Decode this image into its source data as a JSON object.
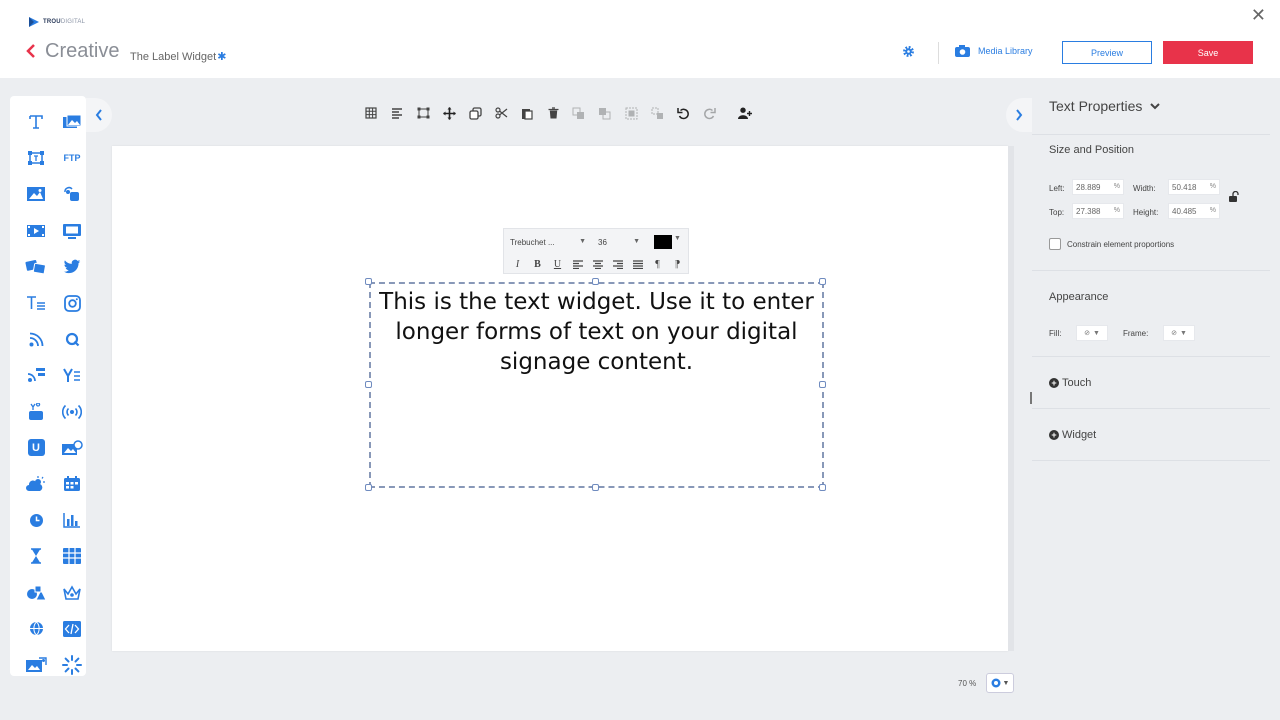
{
  "header": {
    "brand_bold": "TROU",
    "brand_rest": "DIGITAL",
    "app_title": "Creative",
    "widget_name": "The Label Widget",
    "unsaved_marker": "✱",
    "media_library_label": "Media Library",
    "preview_label": "Preview",
    "save_label": "Save",
    "close_glyph": "✕"
  },
  "colors": {
    "accent": "#2a7de1",
    "save": "#e8334a",
    "canvas": "#ffffff",
    "background": "#eceef1"
  },
  "palette": {
    "items": [
      {
        "icon": "text-icon"
      },
      {
        "icon": "image-gallery-icon"
      },
      {
        "icon": "frame-icon"
      },
      {
        "icon": "ftp-icon",
        "text": "FTP"
      },
      {
        "icon": "image-icon"
      },
      {
        "icon": "touch-icon"
      },
      {
        "icon": "video-icon"
      },
      {
        "icon": "screen-icon"
      },
      {
        "icon": "feeds-icon"
      },
      {
        "icon": "twitter-icon"
      },
      {
        "icon": "text-list-icon"
      },
      {
        "icon": "instagram-icon"
      },
      {
        "icon": "rss-icon"
      },
      {
        "icon": "search-query-icon"
      },
      {
        "icon": "rss-cards-icon"
      },
      {
        "icon": "yammer-icon"
      },
      {
        "icon": "youtube-icon"
      },
      {
        "icon": "broadcast-icon"
      },
      {
        "icon": "u-badge-icon",
        "text": "U"
      },
      {
        "icon": "image-360-icon"
      },
      {
        "icon": "weather-icon"
      },
      {
        "icon": "calendar-icon"
      },
      {
        "icon": "clock-icon"
      },
      {
        "icon": "bar-chart-icon"
      },
      {
        "icon": "hourglass-icon"
      },
      {
        "icon": "table-icon"
      },
      {
        "icon": "shapes-icon"
      },
      {
        "icon": "crown-icon"
      },
      {
        "icon": "globe-icon"
      },
      {
        "icon": "code-icon"
      },
      {
        "icon": "slideshow-icon"
      },
      {
        "icon": "spinner-icon"
      }
    ]
  },
  "toolbar": {
    "buttons": [
      "grid-icon",
      "align-icon",
      "fit-icon",
      "move-icon",
      "copy-icon",
      "cut-icon",
      "paste-icon",
      "delete-icon",
      "bring-front-icon",
      "send-back-icon",
      "group-icon",
      "ungroup-icon",
      "undo-icon",
      "redo-icon",
      "add-user-icon"
    ]
  },
  "format_bar": {
    "font": "Trebuchet ...",
    "size": "36",
    "color": "#000000",
    "buttons": [
      "I",
      "B",
      "U",
      "≡",
      "≡",
      "≡",
      "≡",
      "¶",
      "¶"
    ]
  },
  "text_widget": {
    "content": "This is the text widget. Use it to enter longer forms of text on your digital signage content."
  },
  "properties": {
    "title": "Text Properties",
    "size_position": {
      "title": "Size and Position",
      "left_label": "Left:",
      "left": "28.889",
      "width_label": "Width:",
      "width": "50.418",
      "top_label": "Top:",
      "top": "27.388",
      "height_label": "Height:",
      "height": "40.485",
      "unit": "%",
      "constrain_label": "Constrain element proportions",
      "constrain_checked": false
    },
    "appearance": {
      "title": "Appearance",
      "fill_label": "Fill:",
      "frame_label": "Frame:"
    },
    "touch_label": "Touch",
    "widget_label": "Widget"
  },
  "zoom": {
    "value": "70 %"
  }
}
